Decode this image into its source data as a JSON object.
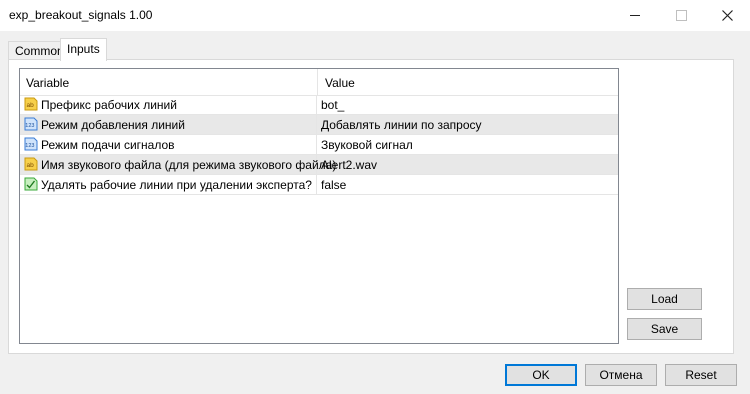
{
  "window": {
    "title": "exp_breakout_signals 1.00"
  },
  "tabs": [
    {
      "label": "Common",
      "active": false
    },
    {
      "label": "Inputs",
      "active": true
    }
  ],
  "grid": {
    "columns": {
      "variable": "Variable",
      "value": "Value"
    },
    "rows": [
      {
        "icon": "string-icon",
        "variable": "Префикс рабочих линий",
        "value": "bot_"
      },
      {
        "icon": "enum-icon",
        "variable": "Режим добавления линий",
        "value": "Добавлять линии по запросу"
      },
      {
        "icon": "enum-icon",
        "variable": "Режим подачи сигналов",
        "value": "Звуковой сигнал"
      },
      {
        "icon": "string-icon",
        "variable": "Имя звукового файла (для режима звукового файла)",
        "value": "Alert2.wav"
      },
      {
        "icon": "bool-icon",
        "variable": "Удалять рабочие линии при удалении эксперта?",
        "value": "false"
      }
    ]
  },
  "buttons": {
    "load": "Load",
    "save": "Save",
    "ok": "OK",
    "cancel": "Отмена",
    "reset": "Reset"
  },
  "icons": {
    "string": {
      "label": "ab",
      "color": "#f0c020"
    },
    "enum": {
      "label": "123",
      "color": "#3a7bd5"
    },
    "bool": {
      "color": "#3aa83a"
    }
  }
}
